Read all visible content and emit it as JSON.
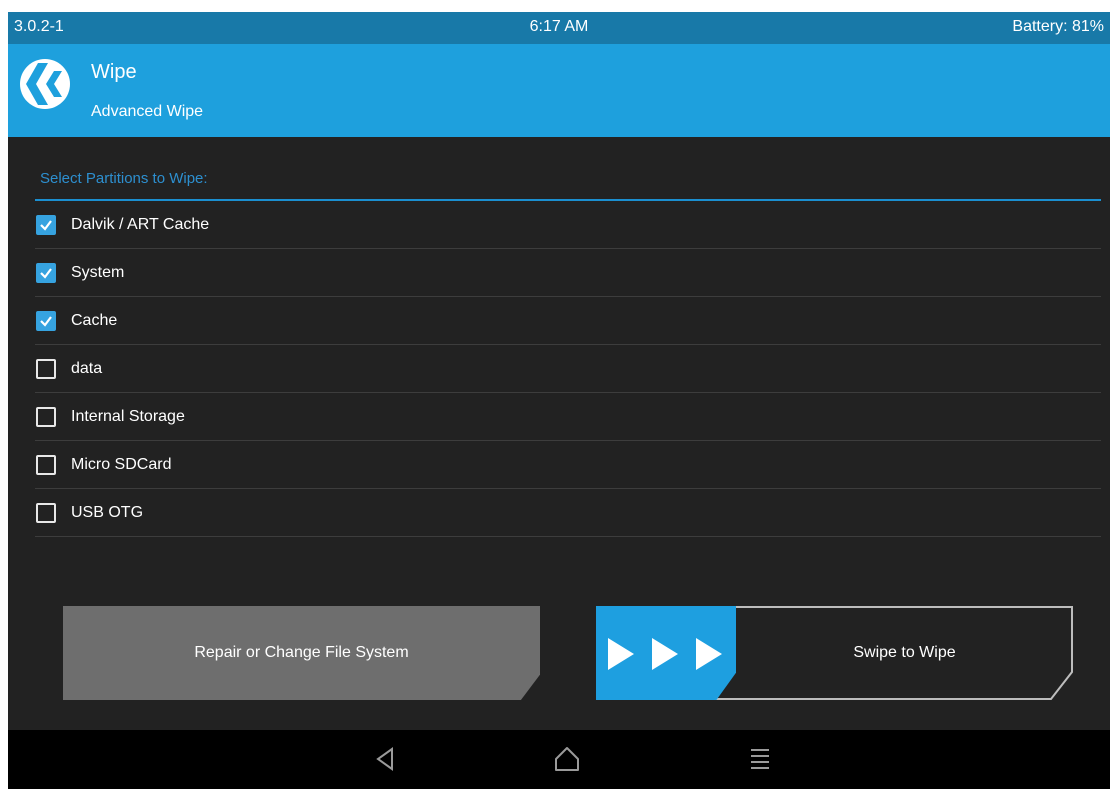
{
  "status_bar": {
    "version": "3.0.2-1",
    "time": "6:17 AM",
    "battery": "Battery: 81%"
  },
  "header": {
    "title": "Wipe",
    "subtitle": "Advanced Wipe",
    "logo_icon": "twrp-logo-icon"
  },
  "partitions": {
    "heading": "Select Partitions to Wipe:",
    "items": [
      {
        "label": "Dalvik / ART Cache",
        "checked": true
      },
      {
        "label": "System",
        "checked": true
      },
      {
        "label": "Cache",
        "checked": true
      },
      {
        "label": "data",
        "checked": false
      },
      {
        "label": "Internal Storage",
        "checked": false
      },
      {
        "label": "Micro SDCard",
        "checked": false
      },
      {
        "label": "USB OTG",
        "checked": false
      }
    ]
  },
  "actions": {
    "repair_label": "Repair or Change File System",
    "swipe_label": "Swipe to Wipe",
    "swipe_icon": "triple-arrow-right-icon"
  },
  "nav_bar": {
    "icons": [
      "back-icon",
      "home-icon",
      "menu-icon"
    ]
  },
  "colors": {
    "status_bar": "#1879a8",
    "header": "#1ea0dd",
    "accent": "#1e9fe0",
    "background": "#222222",
    "button_gray": "#6e6e6e"
  }
}
